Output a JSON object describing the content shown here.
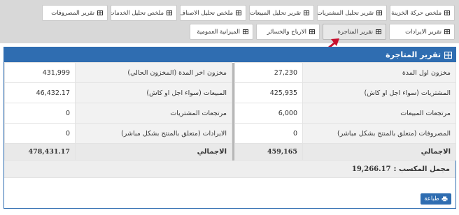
{
  "tabs_row1": [
    {
      "label": "ملخص حركة الخزينة"
    },
    {
      "label": "تقرير تحليل المشتريات"
    },
    {
      "label": "تقرير تحليل المبيعات"
    },
    {
      "label": "ملخص تحليل الاصناف"
    },
    {
      "label": "ملخص تحليل الخدمات"
    },
    {
      "label": "تقرير المصروفات"
    }
  ],
  "tabs_row2": [
    {
      "label": "تقرير الايرادات"
    },
    {
      "label": "تقرير المتاجرة"
    },
    {
      "label": "الارباح والخسائر"
    },
    {
      "label": "الميزانية العمومية"
    }
  ],
  "panel": {
    "title": "تقرير المتاجرة",
    "rows": [
      {
        "l1": "مخزون اول المدة",
        "v1": "27,230",
        "l2": "مخزون اخر المدة (المخزون الحالي)",
        "v2": "431,999"
      },
      {
        "l1": "المشتريات (سواء اجل او كاش)",
        "v1": "425,935",
        "l2": "المبيعات (سواء اجل او كاش)",
        "v2": "46,432.17"
      },
      {
        "l1": "مرتجعات المبيعات",
        "v1": "6,000",
        "l2": "مرتجعات المشتريات",
        "v2": "0"
      },
      {
        "l1": "المصروفات (متعلق بالمنتج بشكل مباشر)",
        "v1": "0",
        "l2": "الايرادات (متعلق بالمنتج بشكل مباشر)",
        "v2": "0"
      }
    ],
    "total": {
      "l1": "الاجمالي",
      "v1": "459,165",
      "l2": "الاجمالي",
      "v2": "478,431.17"
    },
    "profit_label": "مجمل المكسب :",
    "profit_value": "19,266.17",
    "print_label": "طباعة"
  },
  "colors": {
    "accent": "#2f6db1",
    "arrow": "#c8102e"
  }
}
